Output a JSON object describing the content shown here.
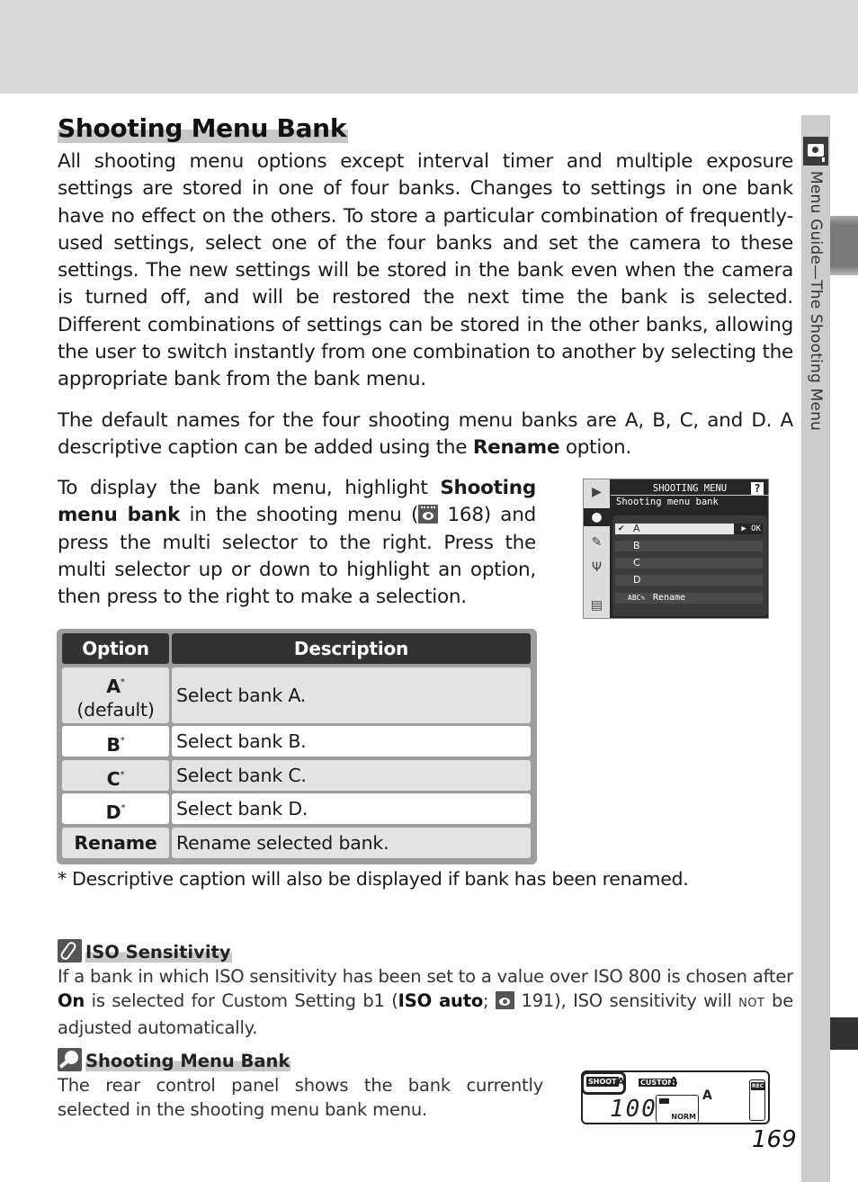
{
  "sidebar": {
    "section_label": "Menu Guide—The Shooting Menu",
    "icon": "camera-icon"
  },
  "title": "Shooting Menu Bank",
  "paragraphs": {
    "p1": "All shooting menu options except interval timer and multiple exposure settings are stored in one of four banks.  Changes to settings in one bank have no effect on the others.  To store a particular combination of frequently-used settings, select one of the four banks and set the camera to these settings.  The new settings will be stored in the bank even when the camera is turned off, and will be restored the next time the bank is selected.  Different combinations of settings can be stored in the other banks, allowing the user to switch instantly from one combination to another by selecting the appropriate bank from the bank menu.",
    "p2_pre": "The default names for the four shooting menu banks are A, B, C, and D.  A descriptive caption can be added using the ",
    "p2_bold": "Rename",
    "p2_post": " option.",
    "p3_pre": "To display the bank menu, highlight ",
    "p3_bold": "Shooting menu bank",
    "p3_mid": " in the shooting menu (",
    "p3_ref": " 168) and press the multi selector to the right.  Press the multi selector up or down to highlight an option, then press to the right to make a selection."
  },
  "camera_screen": {
    "header": "SHOOTING MENU",
    "help": "?",
    "subtitle": "Shooting menu bank",
    "tabs": [
      "playback-icon",
      "camera-icon",
      "pencil-icon",
      "wrench-icon",
      "recent-settings-icon"
    ],
    "items": [
      {
        "check": "✔",
        "label": "A",
        "selected": true,
        "ok": "▶ OK"
      },
      {
        "label": "B"
      },
      {
        "label": "C"
      },
      {
        "label": "D"
      },
      {
        "prefix": "ABC✎",
        "label": "Rename"
      }
    ]
  },
  "table": {
    "headers": [
      "Option",
      "Description"
    ],
    "rows": [
      {
        "option": "A",
        "mark": "*",
        "note": "(default)",
        "description": "Select bank A."
      },
      {
        "option": "B",
        "mark": "*",
        "description": "Select bank B."
      },
      {
        "option": "C",
        "mark": "*",
        "description": "Select bank C."
      },
      {
        "option": "D",
        "mark": "*",
        "description": "Select bank D."
      },
      {
        "option": "Rename",
        "description": "Rename selected bank."
      }
    ]
  },
  "footnote": "* Descriptive caption will also be displayed if bank has been renamed.",
  "notes": [
    {
      "icon": "paperclip-icon",
      "title": "ISO Sensitivity",
      "body_1": "If a bank in which ISO sensitivity has been set to a value over ISO 800 is chosen after ",
      "bold_1": "On",
      "body_2": " is selected for Custom Setting b1 (",
      "bold_2": "ISO auto",
      "body_3": "; ",
      "ref": " 191), ISO sensitivity will ",
      "smallcaps": "NOT",
      "body_4": " be adjusted automatically."
    },
    {
      "icon": "magnifier-icon",
      "title": "Shooting Menu Bank",
      "body": "The rear control panel shows the bank currently selected in the shooting menu bank menu."
    }
  ],
  "control_panel": {
    "shoot_label": "SHOOT",
    "shoot_bank": "A",
    "custom_label": "CUSTOM",
    "custom_bank": "A",
    "iso": "100",
    "quality": "NORM",
    "size": "A",
    "rec": "REC"
  },
  "page_number": "169"
}
